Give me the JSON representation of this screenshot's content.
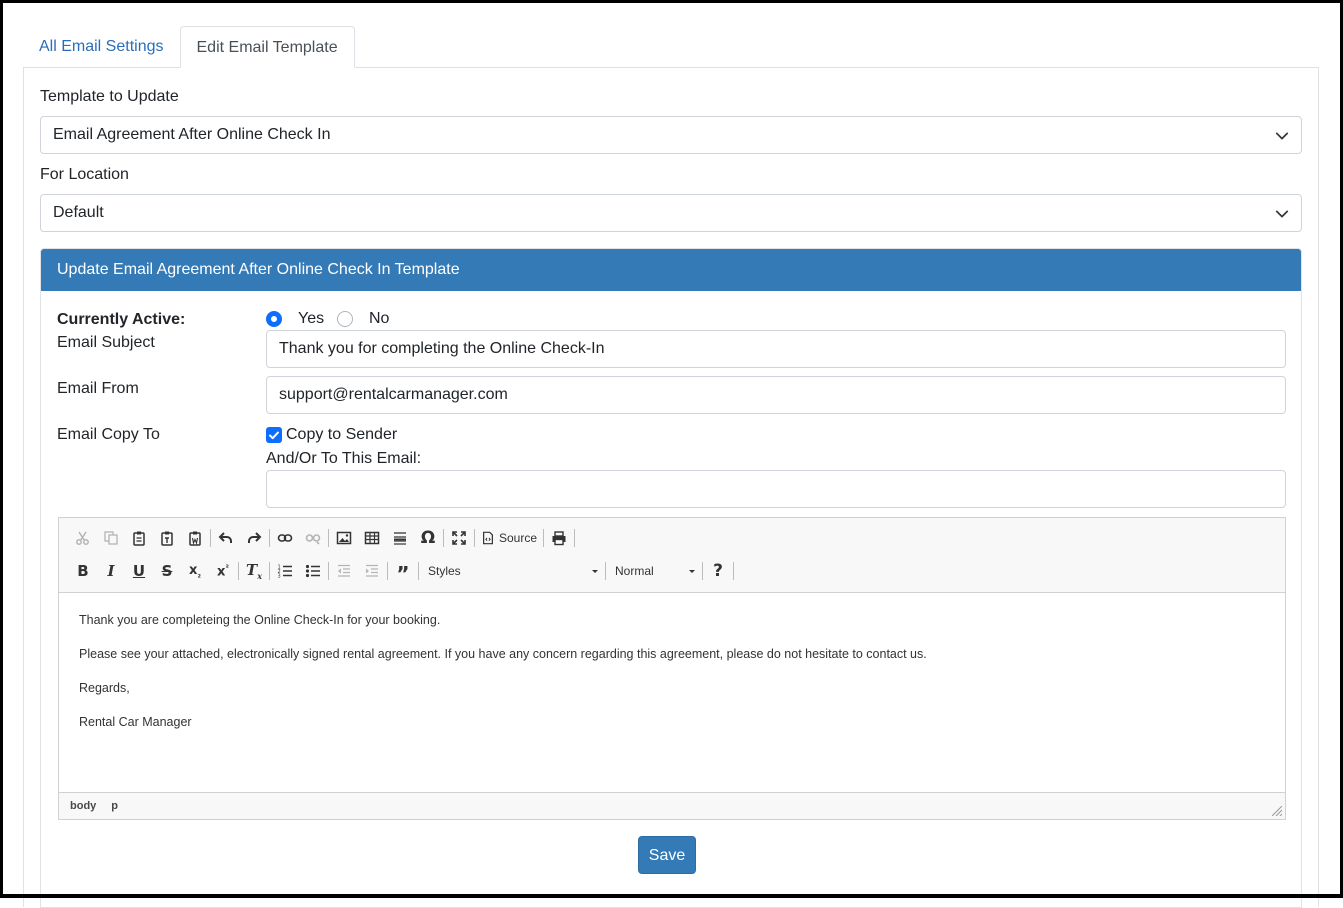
{
  "tabs": [
    {
      "label": "All Email Settings",
      "active": false
    },
    {
      "label": "Edit Email Template",
      "active": true
    }
  ],
  "form": {
    "template_label": "Template to Update",
    "template_value": "Email Agreement After Online Check In",
    "location_label": "For Location",
    "location_value": "Default"
  },
  "panel": {
    "title": "Update Email Agreement After Online Check In Template",
    "active_label": "Currently Active:",
    "yes_label": "Yes",
    "no_label": "No",
    "active_selected": "Yes",
    "subject_label": "Email Subject",
    "subject_value": "Thank you for completing the Online Check-In",
    "from_label": "Email From",
    "from_value": "support@rentalcarmanager.com",
    "copy_label": "Email Copy To",
    "copy_sender_label": "Copy to Sender",
    "copy_sender_checked": true,
    "also_email_label": "And/Or To This Email:",
    "also_email_value": ""
  },
  "editor": {
    "source_label": "Source",
    "styles_label": "Styles",
    "format_label": "Normal",
    "help_glyph": "?",
    "paragraphs": [
      "Thank you are completeing the Online Check-In for your booking.",
      "Please see your attached, electronically signed rental agreement. If you have any concern regarding this agreement, please do not hesitate to contact us.",
      "Regards,",
      "Rental Car Manager"
    ],
    "path": [
      "body",
      "p"
    ]
  },
  "save_label": "Save",
  "colors": {
    "accent": "#337ab7",
    "link": "#2a6ebb",
    "check": "#0d6efd"
  }
}
